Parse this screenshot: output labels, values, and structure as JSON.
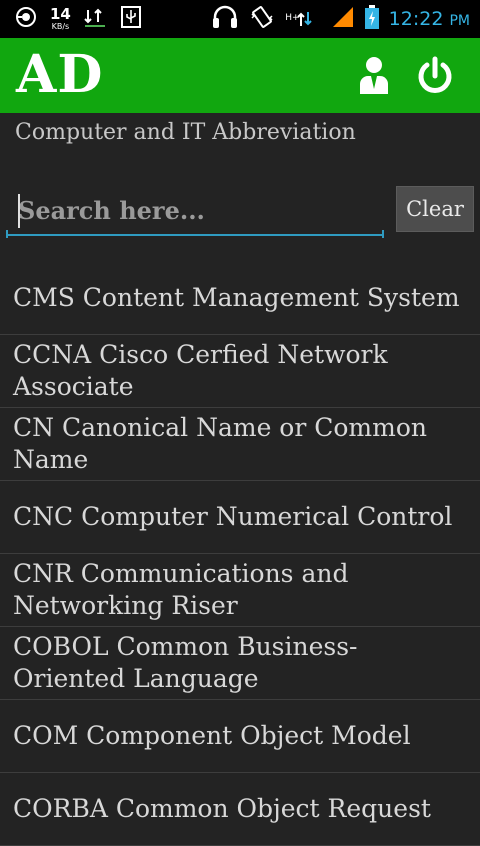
{
  "status_bar": {
    "speed_value": "14",
    "speed_unit": "KB/s",
    "network_label": "H+",
    "time": "12:22",
    "ampm": "PM"
  },
  "app": {
    "title": "AD",
    "subtitle": "Computer and IT Abbreviation"
  },
  "search": {
    "placeholder": "Search here...",
    "value": "",
    "clear_label": "Clear"
  },
  "abbreviations": [
    "CMS Content Management System",
    "CCNA Cisco Cerfied Network Associate",
    "CN Canonical Name or Common Name",
    "CNC Computer Numerical Control",
    "CNR Communications and Networking Riser",
    "COBOL Common Business-Oriented Language",
    "COM Component Object Model",
    "CORBA Common Object Request"
  ],
  "colors": {
    "action_bar": "#11a70f",
    "background": "#232323",
    "accent": "#2f9bc1",
    "clock": "#35b5e5"
  }
}
